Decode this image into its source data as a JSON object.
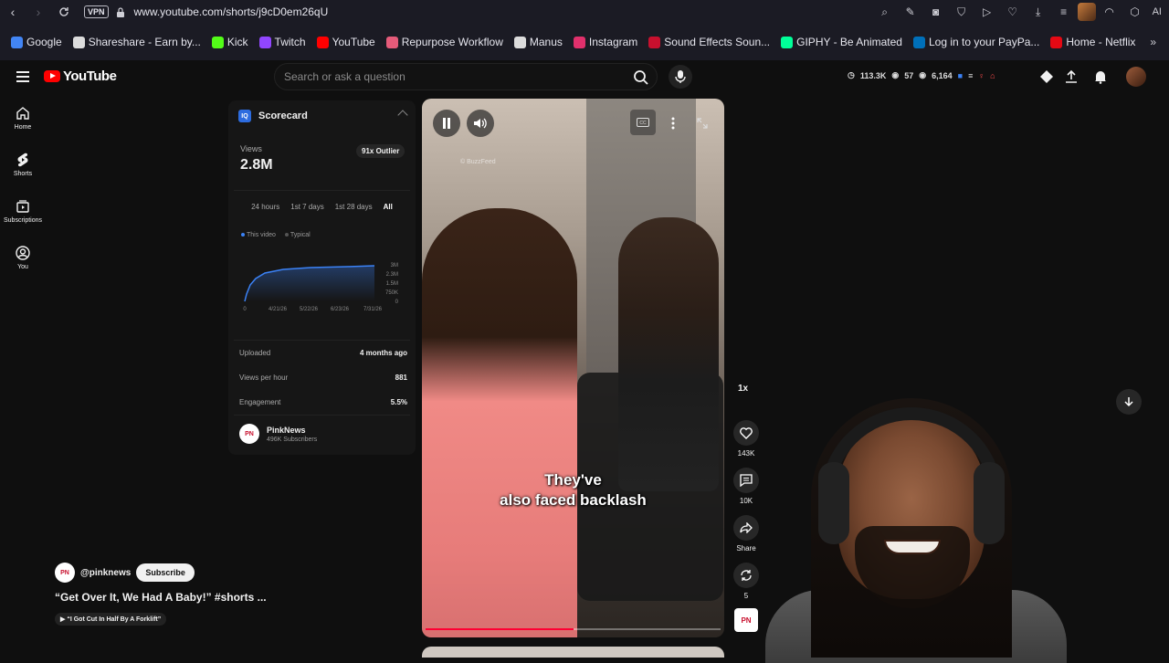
{
  "browser": {
    "url": "www.youtube.com/shorts/j9cD0em26qU",
    "vpn_label": "VPN",
    "ai_label": "AI"
  },
  "bookmarks": [
    {
      "label": "Google",
      "color": "#4285f4"
    },
    {
      "label": "Shareshare - Earn by...",
      "color": "#dcdcdc"
    },
    {
      "label": "Kick",
      "color": "#53fc18"
    },
    {
      "label": "Twitch",
      "color": "#9146ff"
    },
    {
      "label": "YouTube",
      "color": "#ff0000"
    },
    {
      "label": "Repurpose Workflow",
      "color": "#e55b7a"
    },
    {
      "label": "Manus",
      "color": "#dcdcdc"
    },
    {
      "label": "Instagram",
      "color": "#e1306c"
    },
    {
      "label": "Sound Effects Soun...",
      "color": "#c8102e"
    },
    {
      "label": "GIPHY - Be Animated",
      "color": "#00ff99"
    },
    {
      "label": "Log in to your PayPa...",
      "color": "#0070ba"
    },
    {
      "label": "Home - Netflix",
      "color": "#e50914"
    }
  ],
  "youtube": {
    "logo_text": "YouTube",
    "search_placeholder": "Search or ask a question",
    "stats": {
      "views": "113.3K",
      "count2": "57",
      "count3": "6,164"
    },
    "sidebar": [
      {
        "label": "Home",
        "icon": "home-icon"
      },
      {
        "label": "Shorts",
        "icon": "shorts-icon"
      },
      {
        "label": "Subscriptions",
        "icon": "subscriptions-icon"
      },
      {
        "label": "You",
        "icon": "you-icon"
      }
    ]
  },
  "scorecard": {
    "title": "Scorecard",
    "logo_text": "IQ",
    "views_label": "Views",
    "views_value": "2.8M",
    "outlier_badge": "91x Outlier",
    "tabs": [
      "24 hours",
      "1st 7 days",
      "1st 28 days",
      "All"
    ],
    "active_tab": "All",
    "legend": [
      {
        "label": "This video",
        "color": "#3b82f6"
      },
      {
        "label": "Typical",
        "color": "#555555"
      }
    ],
    "chart": {
      "y_ticks": [
        "3M",
        "2.3M",
        "1.5M",
        "750K",
        "0"
      ],
      "x_ticks": [
        "0",
        "4/21/26",
        "5/22/26",
        "6/23/26",
        "7/31/26"
      ],
      "series_color": "#3b82f6"
    },
    "rows": [
      {
        "label": "Uploaded",
        "value": "4 months ago"
      },
      {
        "label": "Views per hour",
        "value": "881"
      },
      {
        "label": "Engagement",
        "value": "5.5%"
      }
    ],
    "channel": {
      "name": "PinkNews",
      "subscribers": "496K Subscribers",
      "logo": "PN"
    }
  },
  "video": {
    "caption_line1": "They've",
    "caption_line2": "also faced backlash",
    "progress": 0.5,
    "watermark": "© BuzzFeed"
  },
  "actions": {
    "speed": "1x",
    "likes": "143K",
    "comments": "10K",
    "share": "Share",
    "remix": "5"
  },
  "meta": {
    "handle": "@pinknews",
    "subscribe": "Subscribe",
    "title": "“Get Over It, We Had A Baby!” #shorts ...",
    "sound": "“I Got Cut In Half By A Forklift”",
    "avatar": "PN"
  }
}
